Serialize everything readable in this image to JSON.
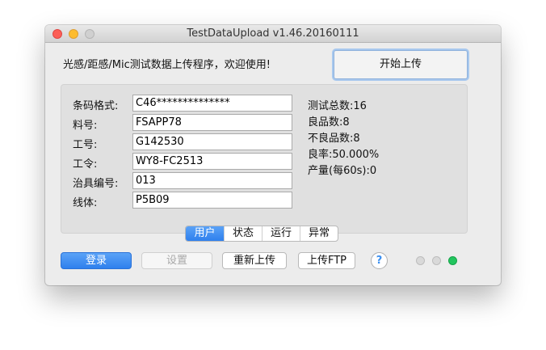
{
  "window": {
    "title": "TestDataUpload v1.46.20160111"
  },
  "header": {
    "welcome": "光感/距感/Mic测试数据上传程序，欢迎使用!",
    "start_button": "开始上传"
  },
  "form": {
    "fields": [
      {
        "label": "条码格式:",
        "value": "C46**************"
      },
      {
        "label": "料号:",
        "value": "FSAPP78"
      },
      {
        "label": "工号:",
        "value": "G142530"
      },
      {
        "label": "工令:",
        "value": "WY8-FC2513"
      },
      {
        "label": "治具编号:",
        "value": "013"
      },
      {
        "label": "线体:",
        "value": "P5B09"
      }
    ]
  },
  "stats": {
    "total": "测试总数:16",
    "good": "良品数:8",
    "bad": "不良品数:8",
    "yield": "良率:50.000%",
    "output": "产量(每60s):0"
  },
  "tabs": [
    "用户",
    "状态",
    "运行",
    "异常"
  ],
  "toolbar": {
    "login": "登录",
    "settings": "设置",
    "reupload": "重新上传",
    "upload_ftp": "上传FTP",
    "help": "?"
  },
  "colors": {
    "accent": "#2f80ed",
    "led_active": "#22c55e",
    "led_inactive": "#d9d9d9"
  }
}
